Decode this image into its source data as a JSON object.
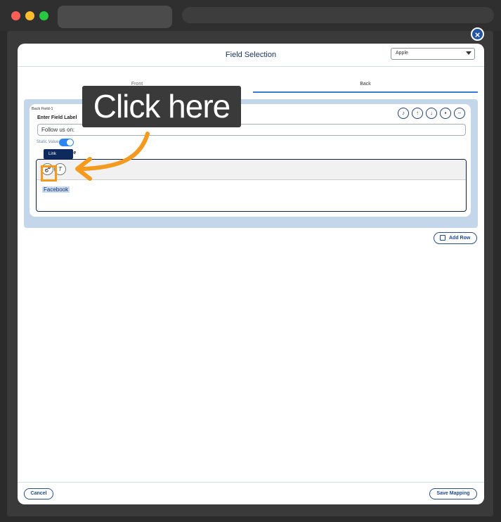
{
  "modal": {
    "title": "Field Selection",
    "select_value": "Apple",
    "tabs": [
      "Front",
      "Back"
    ],
    "active_tab": "Back"
  },
  "field": {
    "id_label": "Back Field-1",
    "enter_label": "Enter Field Label",
    "label_value": "Follow us on:",
    "static_value_label": "Static Value",
    "static_value_on": true,
    "value_label": "Value",
    "editor_content": "Facebook",
    "actions": [
      "bell-icon",
      "arrow-up-icon",
      "arrow-down-icon",
      "trash-icon",
      "minus-icon"
    ]
  },
  "toolbar": {
    "tooltip": "Link",
    "link_glyph": "🔗",
    "clear_glyph": "T"
  },
  "buttons": {
    "add_row": "Add Row",
    "cancel": "Cancel",
    "save_mapping": "Save Mapping"
  },
  "callout": {
    "text": "Click here",
    "color": "#f39a1f"
  },
  "colors": {
    "accent": "#3b7bd6",
    "navy": "#1e4a8f"
  }
}
